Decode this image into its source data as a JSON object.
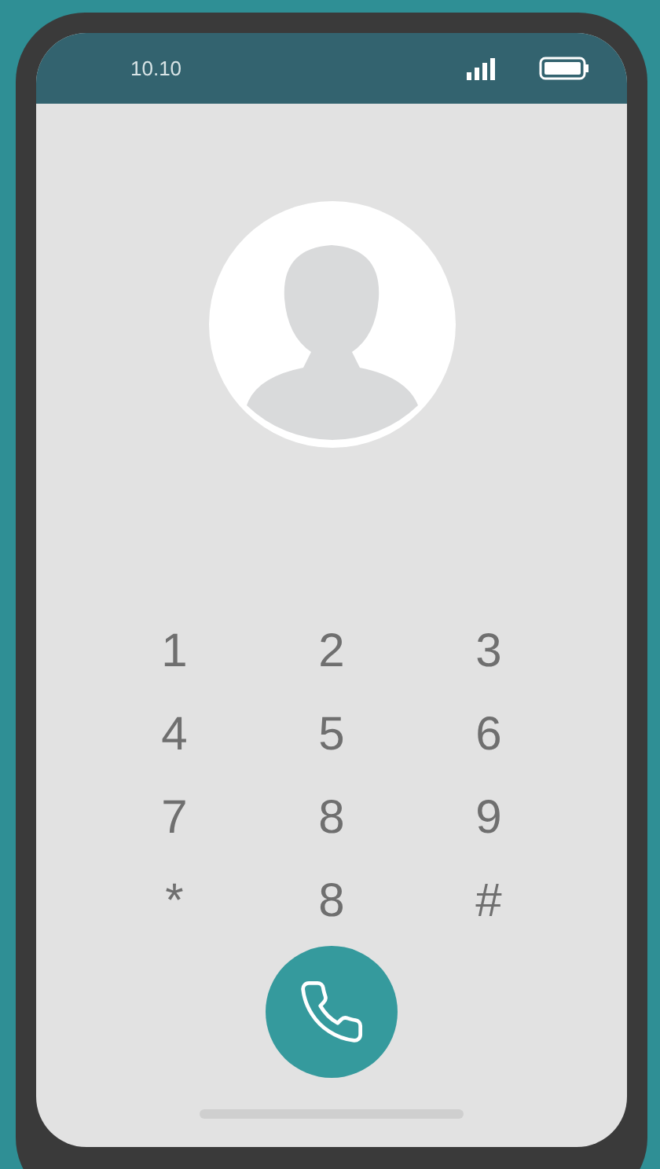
{
  "status_bar": {
    "time": "10.10"
  },
  "keypad": {
    "keys": [
      "1",
      "2",
      "3",
      "4",
      "5",
      "6",
      "7",
      "8",
      "9",
      "*",
      "8",
      "#"
    ]
  }
}
